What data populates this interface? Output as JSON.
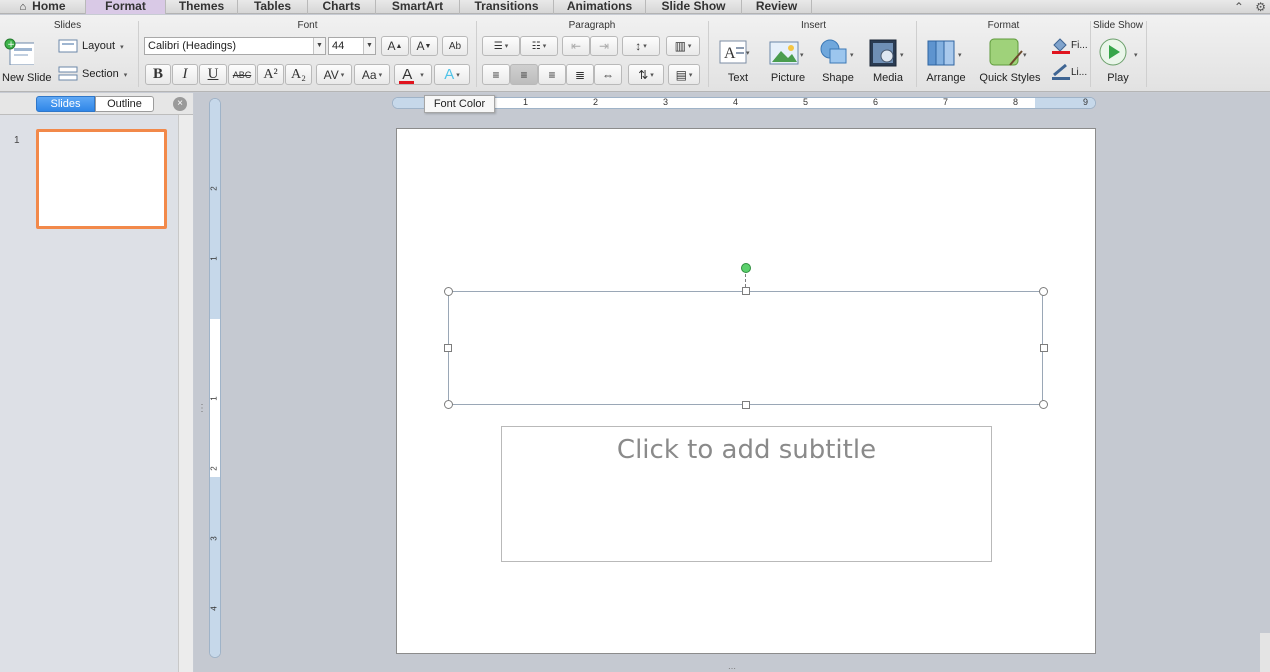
{
  "tabs": [
    {
      "label": "Home",
      "active": false
    },
    {
      "label": "Format",
      "active": true
    },
    {
      "label": "Themes",
      "active": false
    },
    {
      "label": "Tables",
      "active": false
    },
    {
      "label": "Charts",
      "active": false
    },
    {
      "label": "SmartArt",
      "active": false
    },
    {
      "label": "Transitions",
      "active": false
    },
    {
      "label": "Animations",
      "active": false
    },
    {
      "label": "Slide Show",
      "active": false
    },
    {
      "label": "Review",
      "active": false
    }
  ],
  "ribbon": {
    "groups": {
      "slides": "Slides",
      "font": "Font",
      "paragraph": "Paragraph",
      "insert": "Insert",
      "format": "Format",
      "slide_show": "Slide Show"
    },
    "slides": {
      "new_slide": "New Slide",
      "layout": "Layout",
      "section": "Section"
    },
    "font": {
      "font_name": "Calibri (Headings)",
      "font_size": "44",
      "bold": "B",
      "italic": "I",
      "underline": "U",
      "strike": "ABC",
      "superscript": "A²",
      "subscript": "A₂",
      "char_spacing": "AV",
      "change_case": "Aa",
      "font_color": "A",
      "text_effects": "A",
      "grow": "A",
      "shrink": "A",
      "clear": "Ab"
    },
    "insert": {
      "text": "Text",
      "picture": "Picture",
      "shape": "Shape",
      "media": "Media"
    },
    "format": {
      "arrange": "Arrange",
      "quick_styles": "Quick Styles",
      "fill_short": "Fi...",
      "line_short": "Li..."
    },
    "slide_show": {
      "play": "Play"
    }
  },
  "tooltip": "Font Color",
  "left_pane": {
    "tab_slides": "Slides",
    "tab_outline": "Outline",
    "close": "×",
    "slide_number": "1"
  },
  "ruler": {
    "h_numbers": [
      "1",
      "1",
      "2",
      "3",
      "4",
      "5",
      "6",
      "7",
      "8",
      "9"
    ],
    "v_numbers": [
      "2",
      "1",
      "1",
      "2",
      "3",
      "4"
    ]
  },
  "slide": {
    "subtitle_placeholder": "Click to add subtitle"
  },
  "colors": {
    "accent_tab": "#d9c9e6",
    "selected_thumb_border": "#f2894a",
    "font_color_bar": "#e0141e",
    "segment_active": "#2f86e8"
  }
}
